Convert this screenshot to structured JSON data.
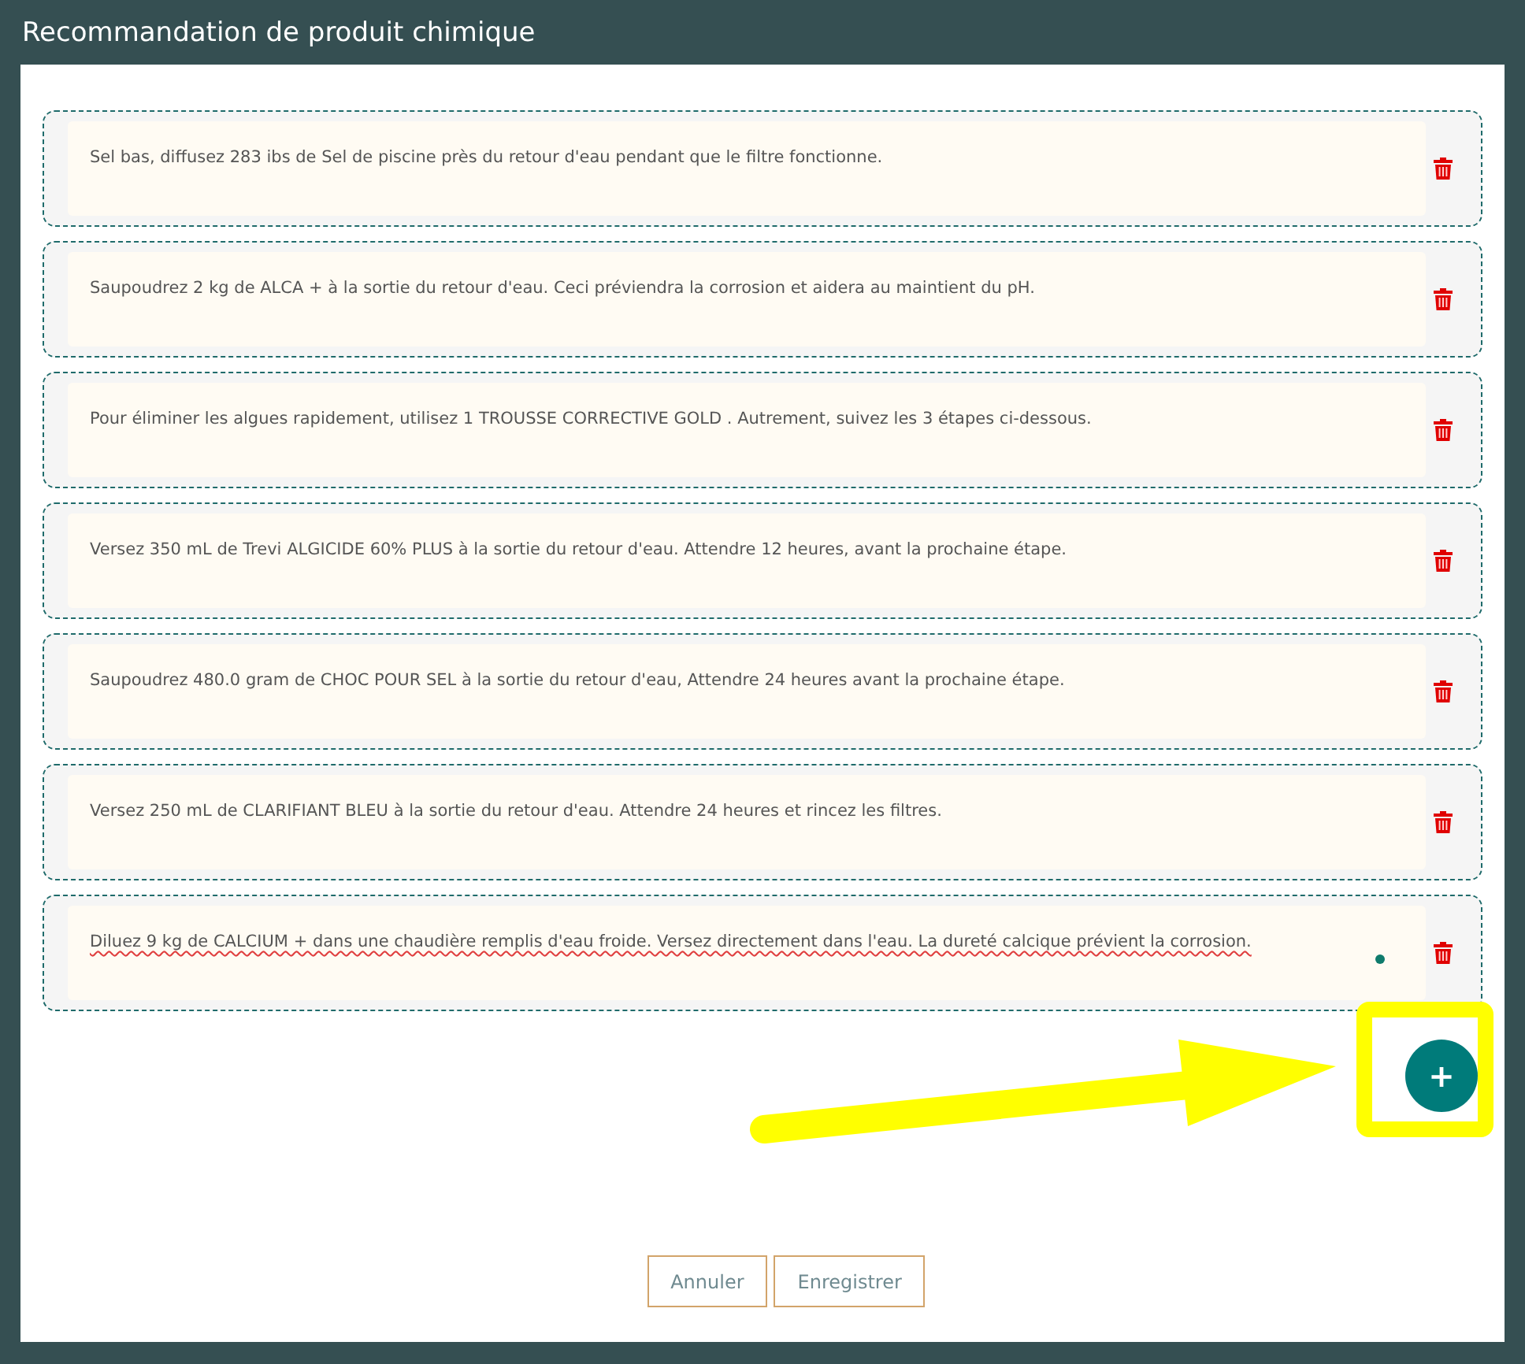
{
  "window": {
    "title": "Recommandation de produit chimique"
  },
  "recommendations": [
    {
      "text": "Sel bas, diffusez 283 ibs de Sel de piscine près du retour d'eau pendant que le filtre fonctionne.",
      "focused": false
    },
    {
      "text": "Saupoudrez 2 kg de ALCA + à la sortie du retour d'eau. Ceci préviendra la corrosion et aidera au maintient du pH.",
      "focused": false
    },
    {
      "text": "Pour éliminer les algues rapidement, utilisez 1 TROUSSE CORRECTIVE GOLD . Autrement, suivez les 3 étapes ci-dessous.",
      "focused": false
    },
    {
      "text": "Versez 350 mL de Trevi ALGICIDE 60% PLUS à la sortie du retour d'eau. Attendre 12 heures, avant la prochaine étape.",
      "focused": false
    },
    {
      "text": "Saupoudrez 480.0 gram de CHOC POUR SEL à la sortie du retour d'eau, Attendre 24 heures avant la prochaine étape.",
      "focused": false
    },
    {
      "text": "Versez 250 mL de CLARIFIANT BLEU à la sortie du retour d'eau. Attendre 24 heures et rincez les filtres.",
      "focused": false
    },
    {
      "text": "Diluez 9 kg de CALCIUM + dans une chaudière remplis d'eau froide. Versez directement dans l'eau. La dureté calcique prévient la corrosion.",
      "focused": true
    }
  ],
  "add_button": {
    "label": "+"
  },
  "annotation": {
    "arrow": true,
    "highlight": true
  },
  "buttons": [
    "Annuler",
    "Enregistrer"
  ]
}
